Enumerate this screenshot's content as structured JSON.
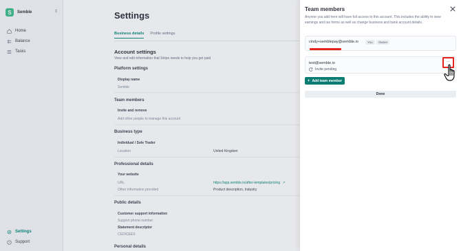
{
  "sidebar": {
    "brand": "Semble",
    "items": [
      {
        "label": "Home",
        "icon": "home-icon"
      },
      {
        "label": "Balance",
        "icon": "balance-icon"
      },
      {
        "label": "Tasks",
        "icon": "tasks-icon"
      }
    ],
    "bottom_items": [
      {
        "label": "Settings",
        "icon": "gear-icon"
      },
      {
        "label": "Support",
        "icon": "help-icon"
      }
    ]
  },
  "main": {
    "title": "Settings",
    "tabs": [
      "Business details",
      "Profile settings"
    ],
    "account_settings": {
      "title": "Account settings",
      "description": "View and edit information that Stripe needs to help you get paid"
    },
    "platform_settings": {
      "title": "Platform settings",
      "display_name_label": "Display name",
      "display_name_value": "Semble"
    },
    "team_members": {
      "title": "Team members",
      "invite_label": "Invite and remove",
      "invite_desc": "Add other people to manage this account"
    },
    "business_type": {
      "title": "Business type",
      "label": "Individual / Sole Trader",
      "location_label": "Location",
      "location_value": "United Kingdom"
    },
    "professional_details": {
      "title": "Professional details",
      "website_title": "Your website",
      "url_label": "URL",
      "url_value": "https://app.semble.io/after-templates/pricing",
      "other_label": "Other information provided",
      "other_value": "Product description, Industry"
    },
    "public_details": {
      "title": "Public details",
      "support_title": "Customer support information",
      "support_phone": "Support phone number",
      "statement_label": "Statement descriptor",
      "statement_value": "CEDICEES"
    },
    "personal_details": {
      "title": "Personal details"
    }
  },
  "drawer": {
    "title": "Team members",
    "description": "Anyone you add here will have full access to this account. This includes the ability to view earnings and tax forms as well as change business and bank account details.",
    "members": [
      {
        "email": "cindy+semblepay@semble.io",
        "badges": [
          "You",
          "Owner"
        ]
      },
      {
        "email": "test@semble.io",
        "status": "Invite pending"
      }
    ],
    "remove_icon": "more-icon",
    "add_button": "Add team member",
    "done_button": "Done"
  },
  "colors": {
    "accent": "#0a7c72",
    "highlight": "#e5231b"
  }
}
